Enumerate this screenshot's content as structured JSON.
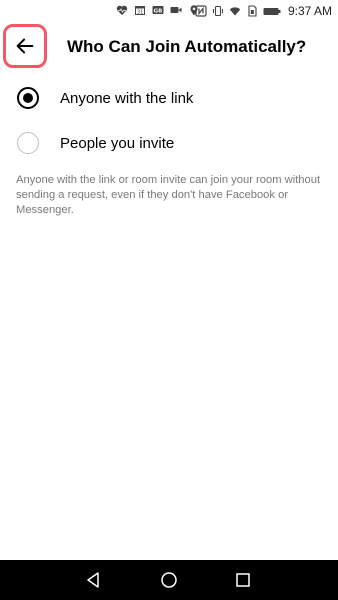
{
  "status_bar": {
    "time": "9:37 AM",
    "left_icons": [
      "heart-monitor-icon",
      "calendar-icon",
      "hd-icon",
      "video-icon",
      "location-icon"
    ],
    "right_icons": [
      "nfc-icon",
      "vibrate-icon",
      "wifi-icon",
      "sim-icon",
      "battery-icon"
    ]
  },
  "header": {
    "title": "Who Can Join Automatically?",
    "back_icon": "back-arrow-icon",
    "highlight_color": "#f05a66"
  },
  "options": [
    {
      "label": "Anyone with the link",
      "selected": true
    },
    {
      "label": "People you invite",
      "selected": false
    }
  ],
  "description": "Anyone with the link or room invite can join your room without sending a request, even if they don't have Facebook or Messenger.",
  "nav_bar": {
    "buttons": [
      "back-triangle-icon",
      "home-circle-icon",
      "recents-square-icon"
    ]
  }
}
